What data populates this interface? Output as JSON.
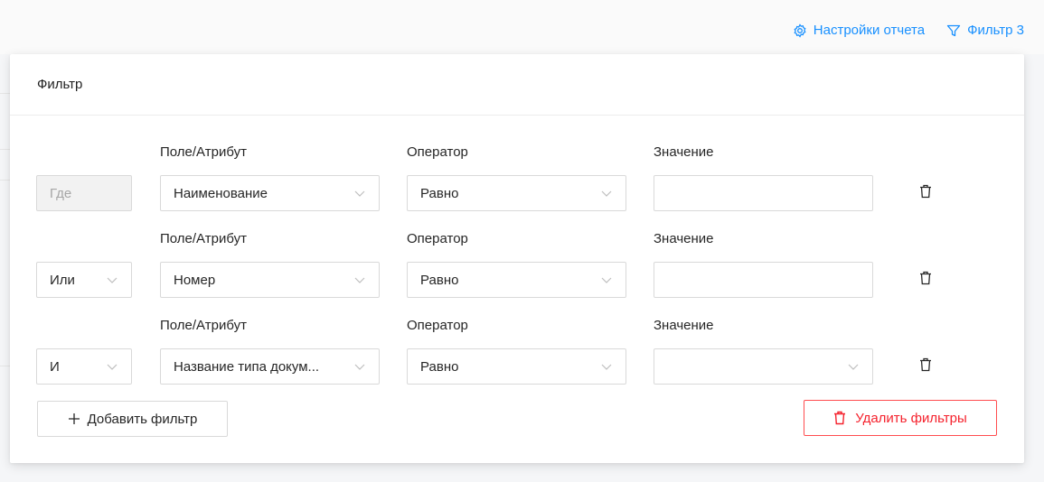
{
  "top_actions": {
    "report_settings": "Настройки отчета",
    "filter": "Фильтр 3"
  },
  "panel": {
    "title": "Фильтр"
  },
  "labels": {
    "field": "Поле/Атрибут",
    "operator": "Оператор",
    "value": "Значение"
  },
  "rows": [
    {
      "logic": "Где",
      "logic_disabled": true,
      "field": "Наименование",
      "operator": "Равно",
      "value": "",
      "value_is_select": false
    },
    {
      "logic": "Или",
      "logic_disabled": false,
      "field": "Номер",
      "operator": "Равно",
      "value": "",
      "value_is_select": false
    },
    {
      "logic": "И",
      "logic_disabled": false,
      "field": "Название типа докум...",
      "operator": "Равно",
      "value": "",
      "value_is_select": true
    }
  ],
  "buttons": {
    "add_filter": "Добавить фильтр",
    "delete_filters": "Удалить фильтры"
  },
  "colors": {
    "accent": "#1890ff",
    "danger": "#f5222d"
  }
}
